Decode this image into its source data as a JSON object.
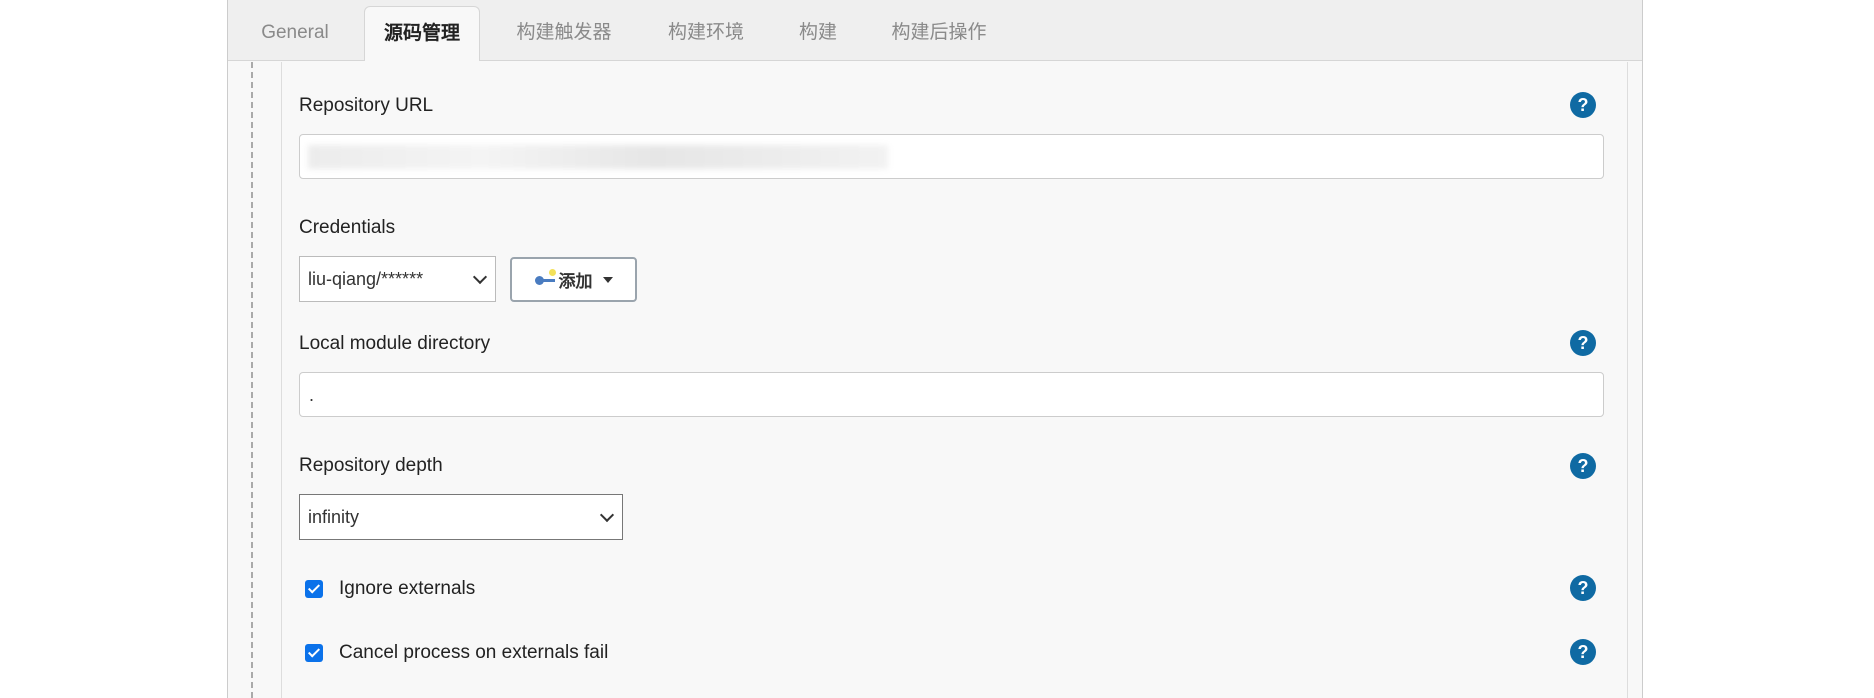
{
  "tabs": [
    {
      "label": "General",
      "active": false
    },
    {
      "label": "源码管理",
      "active": true
    },
    {
      "label": "构建触发器",
      "active": false
    },
    {
      "label": "构建环境",
      "active": false
    },
    {
      "label": "构建",
      "active": false
    },
    {
      "label": "构建后操作",
      "active": false
    }
  ],
  "repository_url": {
    "label": "Repository URL",
    "value_redacted": true
  },
  "credentials": {
    "label": "Credentials",
    "selected": "liu-qiang/******",
    "add_button": "添加"
  },
  "local_module": {
    "label": "Local module directory",
    "value": "."
  },
  "repository_depth": {
    "label": "Repository depth",
    "selected": "infinity"
  },
  "checkboxes": [
    {
      "label": "Ignore externals",
      "checked": true
    },
    {
      "label": "Cancel process on externals fail",
      "checked": true
    }
  ],
  "help_icon": "?",
  "colors": {
    "help": "#0f6aa3",
    "checkbox": "#0b72ea"
  }
}
